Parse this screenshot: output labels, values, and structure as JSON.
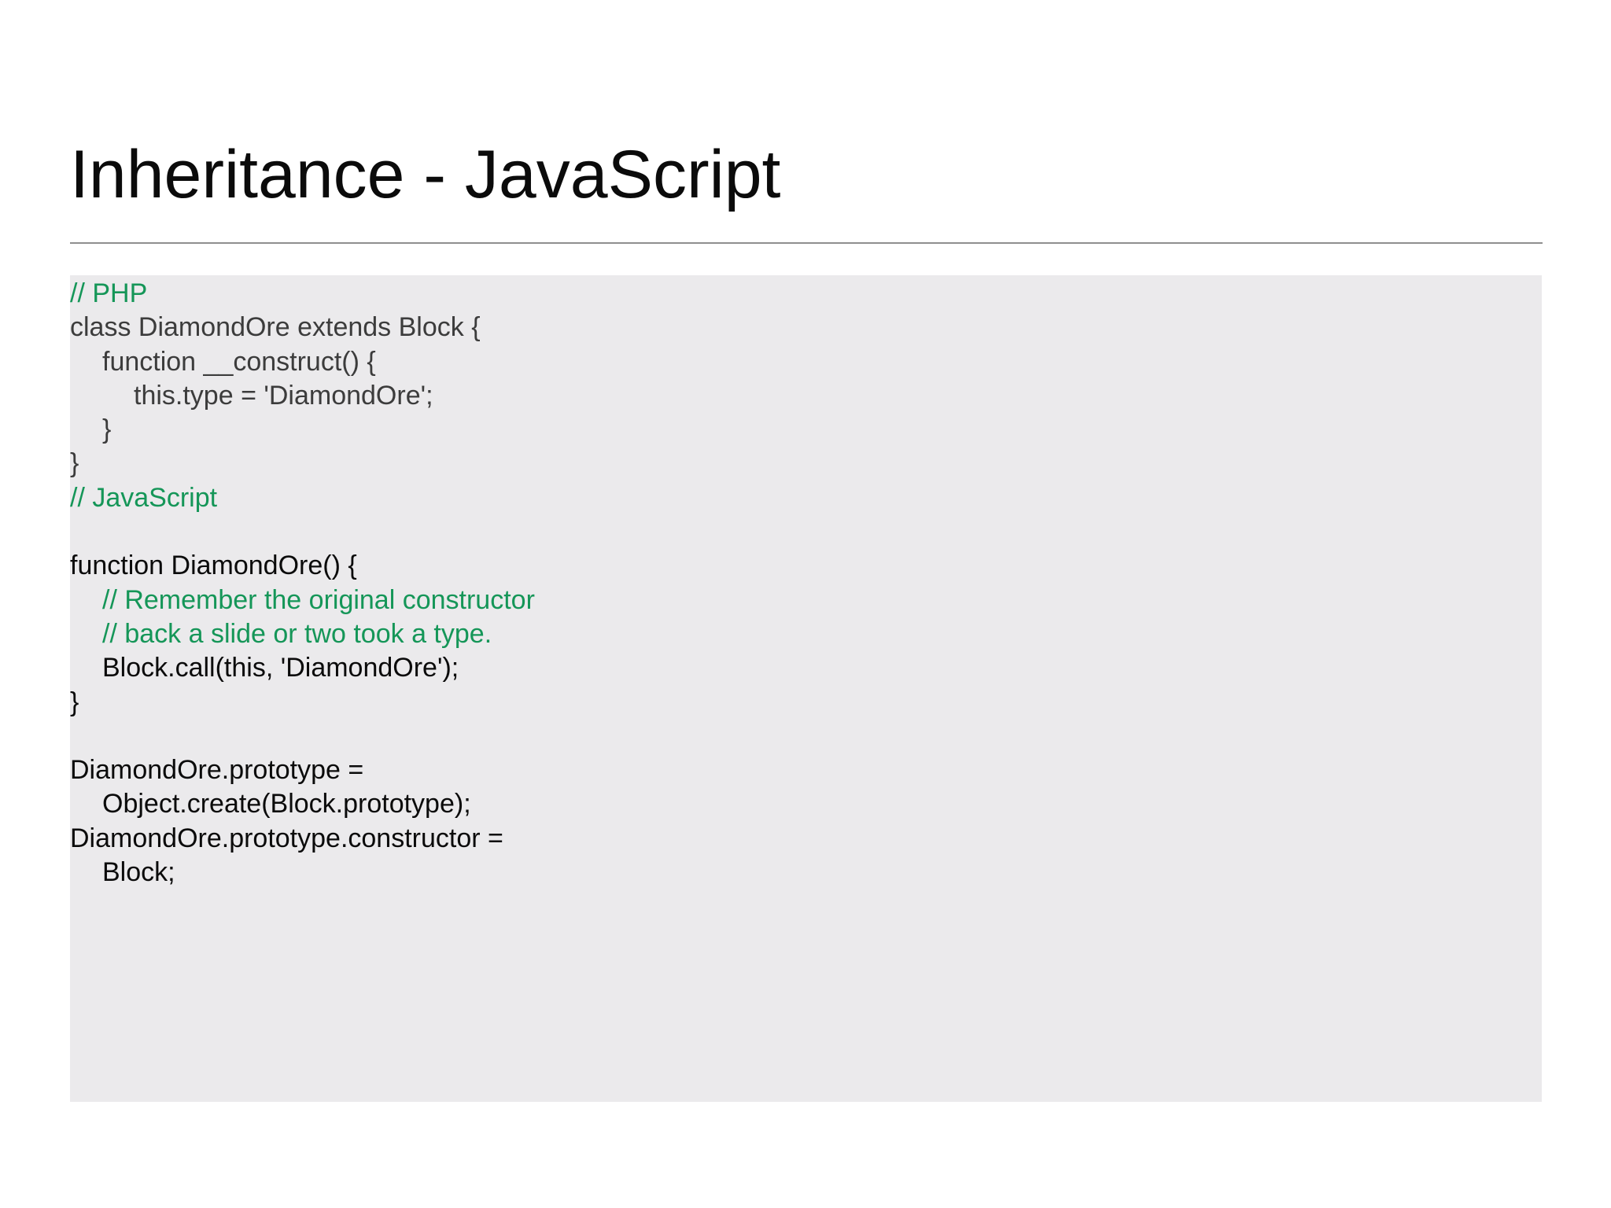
{
  "slide": {
    "title": "Inheritance - JavaScript"
  },
  "code": {
    "lines": [
      {
        "text": "// PHP",
        "tone": "comment",
        "indent": 0
      },
      {
        "text": "class DiamondOre extends Block {",
        "tone": "php",
        "indent": 0
      },
      {
        "text": "function __construct() {",
        "tone": "php",
        "indent": 1
      },
      {
        "text": "this.type = 'DiamondOre';",
        "tone": "php",
        "indent": 2
      },
      {
        "text": "}",
        "tone": "php",
        "indent": 1
      },
      {
        "text": "}",
        "tone": "php",
        "indent": 0
      },
      {
        "text": "// JavaScript",
        "tone": "comment",
        "indent": 0
      },
      {
        "text": "",
        "tone": "js",
        "indent": 0
      },
      {
        "text": "function DiamondOre() {",
        "tone": "js",
        "indent": 0
      },
      {
        "text": "// Remember the original constructor",
        "tone": "comment",
        "indent": 1
      },
      {
        "text": "// back a slide or two took a type.",
        "tone": "comment",
        "indent": 1
      },
      {
        "text": "Block.call(this, 'DiamondOre');",
        "tone": "js",
        "indent": 1
      },
      {
        "text": "}",
        "tone": "js",
        "indent": 0
      },
      {
        "text": "",
        "tone": "js",
        "indent": 0
      },
      {
        "text": "DiamondOre.prototype =",
        "tone": "js",
        "indent": 0
      },
      {
        "text": "Object.create(Block.prototype);",
        "tone": "js",
        "indent": 1
      },
      {
        "text": "DiamondOre.prototype.constructor =",
        "tone": "js",
        "indent": 0
      },
      {
        "text": "Block;",
        "tone": "js",
        "indent": 1
      }
    ]
  },
  "colors": {
    "comment": "#159658",
    "php_code": "#3c3c3c",
    "js_code": "#0b0b0b",
    "panel_background": "#ebeaec",
    "divider": "#8f8f8f"
  }
}
